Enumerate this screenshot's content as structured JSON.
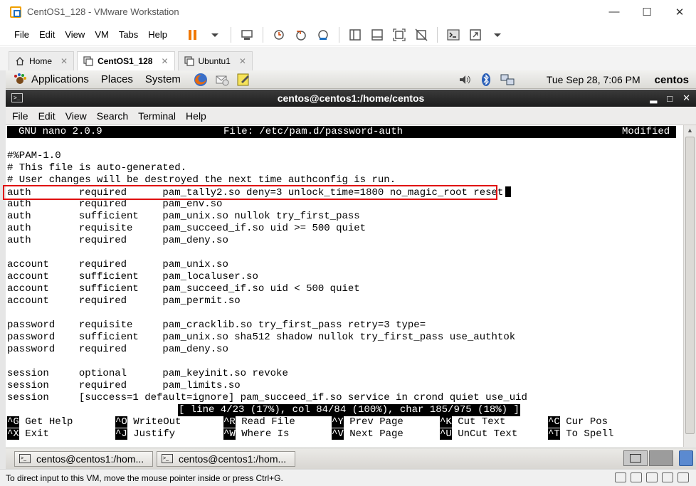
{
  "vmware": {
    "window_title": "CentOS1_128 - VMware Workstation",
    "menu": [
      "File",
      "Edit",
      "View",
      "VM",
      "Tabs",
      "Help"
    ],
    "tabs": [
      {
        "label": "Home",
        "active": false
      },
      {
        "label": "CentOS1_128",
        "active": true
      },
      {
        "label": "Ubuntu1",
        "active": false
      }
    ],
    "status_message": "To direct input to this VM, move the mouse pointer inside or press Ctrl+G."
  },
  "gnome_panel": {
    "menus": [
      "Applications",
      "Places",
      "System"
    ],
    "clock": "Tue Sep 28,  7:06 PM",
    "user": "centos"
  },
  "terminal": {
    "title": "centos@centos1:/home/centos",
    "menu": [
      "File",
      "Edit",
      "View",
      "Search",
      "Terminal",
      "Help"
    ]
  },
  "nano": {
    "version": "GNU nano 2.0.9",
    "file": "File: /etc/pam.d/password-auth",
    "state": "Modified",
    "lines": [
      "#%PAM-1.0",
      "# This file is auto-generated.",
      "# User changes will be destroyed the next time authconfig is run.",
      "auth        required      pam_tally2.so deny=3 unlock_time=1800 no_magic_root reset",
      "auth        required      pam_env.so",
      "auth        sufficient    pam_unix.so nullok try_first_pass",
      "auth        requisite     pam_succeed_if.so uid >= 500 quiet",
      "auth        required      pam_deny.so",
      "",
      "account     required      pam_unix.so",
      "account     sufficient    pam_localuser.so",
      "account     sufficient    pam_succeed_if.so uid < 500 quiet",
      "account     required      pam_permit.so",
      "",
      "password    requisite     pam_cracklib.so try_first_pass retry=3 type=",
      "password    sufficient    pam_unix.so sha512 shadow nullok try_first_pass use_authtok",
      "password    required      pam_deny.so",
      "",
      "session     optional      pam_keyinit.so revoke",
      "session     required      pam_limits.so",
      "session     [success=1 default=ignore] pam_succeed_if.so service in crond quiet use_uid"
    ],
    "status": "[ line 4/23 (17%), col 84/84 (100%), char 185/975 (18%) ]",
    "shortcuts_row1": [
      {
        "key": "^G",
        "label": "Get Help"
      },
      {
        "key": "^O",
        "label": "WriteOut"
      },
      {
        "key": "^R",
        "label": "Read File"
      },
      {
        "key": "^Y",
        "label": "Prev Page"
      },
      {
        "key": "^K",
        "label": "Cut Text"
      },
      {
        "key": "^C",
        "label": "Cur Pos"
      }
    ],
    "shortcuts_row2": [
      {
        "key": "^X",
        "label": "Exit"
      },
      {
        "key": "^J",
        "label": "Justify"
      },
      {
        "key": "^W",
        "label": "Where Is"
      },
      {
        "key": "^V",
        "label": "Next Page"
      },
      {
        "key": "^U",
        "label": "UnCut Text"
      },
      {
        "key": "^T",
        "label": "To Spell"
      }
    ]
  },
  "taskbar": {
    "items": [
      "centos@centos1:/hom...",
      "centos@centos1:/hom..."
    ]
  }
}
